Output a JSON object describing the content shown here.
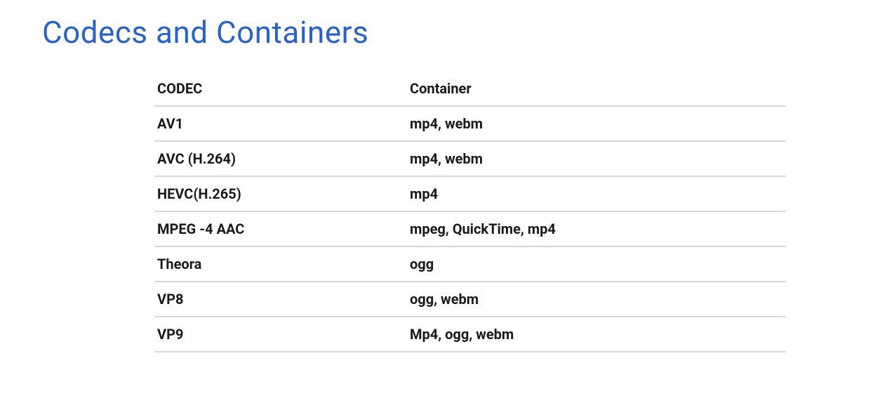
{
  "title": "Codecs and Containers",
  "table": {
    "headers": {
      "codec": "CODEC",
      "container": "Container"
    },
    "rows": [
      {
        "codec": "AV1",
        "container": "mp4, webm"
      },
      {
        "codec": "AVC (H.264)",
        "container": "mp4, webm"
      },
      {
        "codec": "HEVC(H.265)",
        "container": "mp4"
      },
      {
        "codec": "MPEG -4 AAC",
        "container": "mpeg, QuickTime, mp4"
      },
      {
        "codec": "Theora",
        "container": "ogg"
      },
      {
        "codec": "VP8",
        "container": "ogg, webm"
      },
      {
        "codec": "VP9",
        "container": "Mp4, ogg, webm"
      }
    ]
  }
}
